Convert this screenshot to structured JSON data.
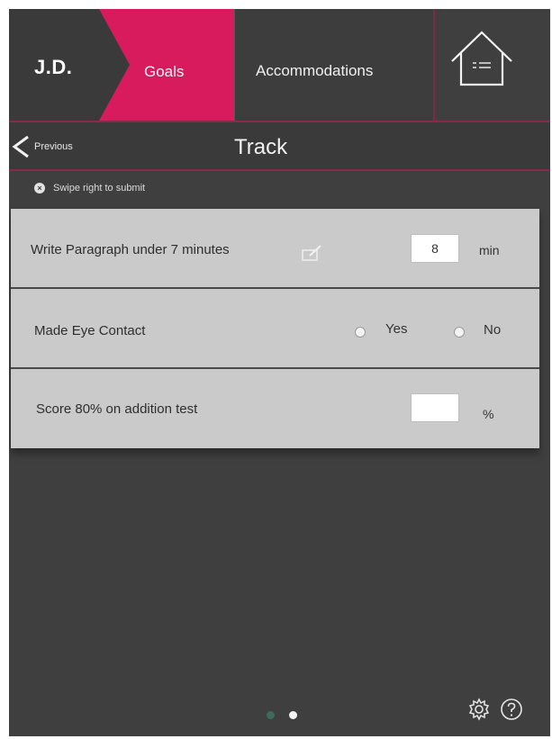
{
  "nav": {
    "user_initials": "J.D.",
    "tabs": [
      {
        "label": "Goals",
        "active": true
      },
      {
        "label": "Accommodations",
        "active": false
      }
    ],
    "home_icon": "home-list-icon"
  },
  "header": {
    "back_label": "Previous",
    "title": "Track"
  },
  "hint": {
    "icon": "close-circle-icon",
    "text": "Swipe right to submit"
  },
  "goals": [
    {
      "label": "Write Paragraph under 7 minutes",
      "input_value": "8",
      "unit": "min",
      "icon": "edit-note-icon"
    },
    {
      "label": "Made Eye Contact",
      "options": [
        "Yes",
        "No"
      ]
    },
    {
      "label": "Score 80% on addition test",
      "input_value": "",
      "unit": "%"
    }
  ],
  "footer": {
    "page_count": 2,
    "active_page": 2,
    "icons": [
      "settings-gear-icon",
      "help-icon"
    ]
  },
  "colors": {
    "accent": "#d81b5c",
    "nav_bg": "#3c3c3c",
    "body_bg": "#3f3f3f",
    "card_bg": "#cacaca"
  }
}
